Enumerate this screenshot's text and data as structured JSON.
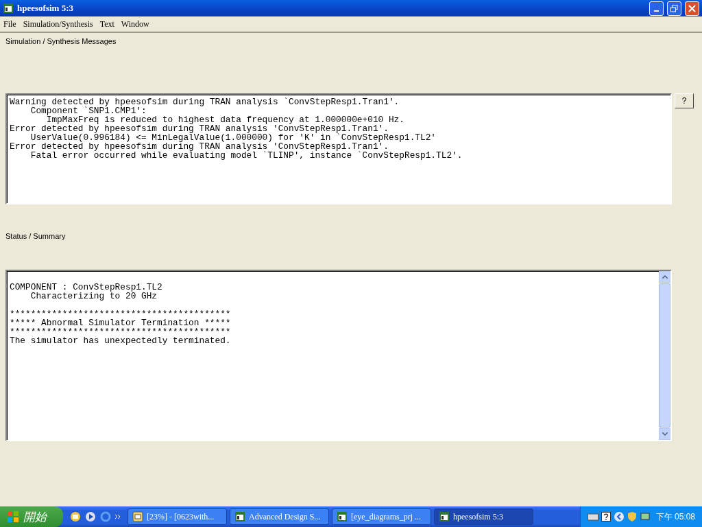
{
  "window": {
    "title": "hpeesofsim 5:3"
  },
  "menu": [
    {
      "label": "File"
    },
    {
      "label": "Simulation/Synthesis"
    },
    {
      "label": "Text"
    },
    {
      "label": "Window"
    }
  ],
  "messages": {
    "label": "Simulation / Synthesis Messages",
    "help_button": "?",
    "lines": [
      "Warning detected by hpeesofsim during TRAN analysis `ConvStepResp1.Tran1'.",
      "    Component `SNP1.CMP1':",
      "       ImpMaxFreq is reduced to highest data frequency at 1.000000e+010 Hz.",
      "Error detected by hpeesofsim during TRAN analysis 'ConvStepResp1.Tran1'.",
      "    UserValue(0.996184) <= MinLegalValue(1.000000) for 'K' in `ConvStepResp1.TL2'",
      "Error detected by hpeesofsim during TRAN analysis 'ConvStepResp1.Tran1'.",
      "    Fatal error occurred while evaluating model `TLINP', instance `ConvStepResp1.TL2'."
    ]
  },
  "status": {
    "label": "Status / Summary",
    "lines": [
      {
        "lines": [
          "COMPONENT : ConvStepResp1.TL2",
          "    Characterizing to 20 GHz"
        ]
      },
      {
        "lines": [
          "******************************************",
          "***** Abnormal Simulator Termination *****",
          "******************************************",
          "The simulator has unexpectedly terminated."
        ]
      }
    ]
  },
  "taskbar": {
    "start": "開始",
    "tasks": [
      {
        "label": "[23%] - [0623with...",
        "kind": "viewer",
        "selected": false
      },
      {
        "label": "Advanced Design S...",
        "kind": "app",
        "selected": false
      },
      {
        "label": "[eye_diagrams_prj ...",
        "kind": "schematic",
        "selected": false
      },
      {
        "label": "hpeesofsim 5:3",
        "kind": "app",
        "selected": true
      }
    ],
    "clock": "下午 05:08"
  }
}
